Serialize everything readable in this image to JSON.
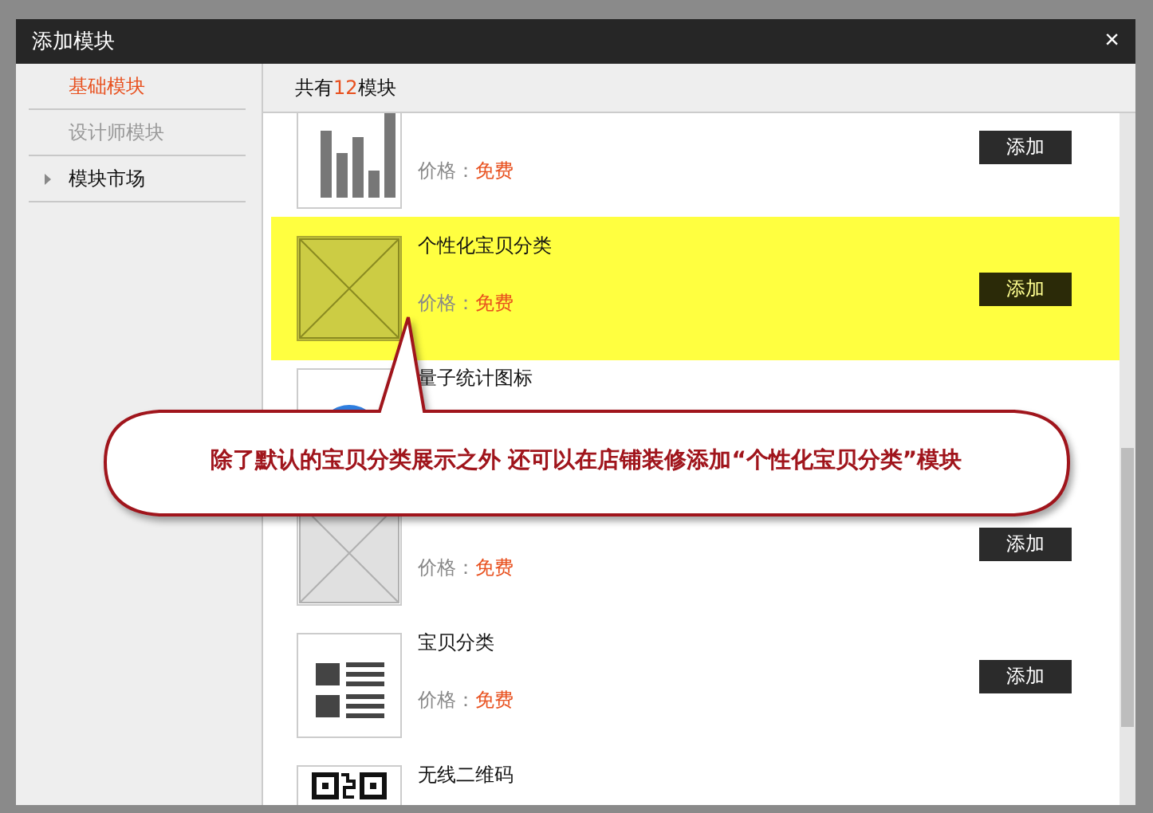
{
  "dialog": {
    "title": "添加模块",
    "close": "×"
  },
  "sidebar": {
    "items": [
      {
        "label": "基础模块",
        "selected": true,
        "disabled": false,
        "arrow": false
      },
      {
        "label": "设计师模块",
        "selected": false,
        "disabled": true,
        "arrow": false
      },
      {
        "label": "模块市场",
        "selected": false,
        "disabled": false,
        "arrow": true
      }
    ]
  },
  "header": {
    "prefix": "共有",
    "count": "12",
    "suffix": "模块"
  },
  "modules": [
    {
      "kind": "bars",
      "highlighted": false,
      "price_label": "价格：",
      "price": "免费",
      "button": "添加"
    },
    {
      "kind": "placeholder",
      "highlighted": true,
      "name": "个性化宝贝分类",
      "price_label": "价格：",
      "price": "免费",
      "button": "添加"
    },
    {
      "kind": "circle",
      "highlighted": false,
      "name": "量子统计图标"
    },
    {
      "kind": "placeholder",
      "highlighted": false,
      "price_label": "价格：",
      "price": "免费",
      "button": "添加"
    },
    {
      "kind": "list",
      "highlighted": false,
      "name": "宝贝分类",
      "price_label": "价格：",
      "price": "免费",
      "button": "添加"
    },
    {
      "kind": "qr",
      "highlighted": false,
      "name": "无线二维码"
    }
  ],
  "callout": {
    "text": "除了默认的宝贝分类展示之外 还可以在店铺装修添加“个性化宝贝分类”模块"
  }
}
